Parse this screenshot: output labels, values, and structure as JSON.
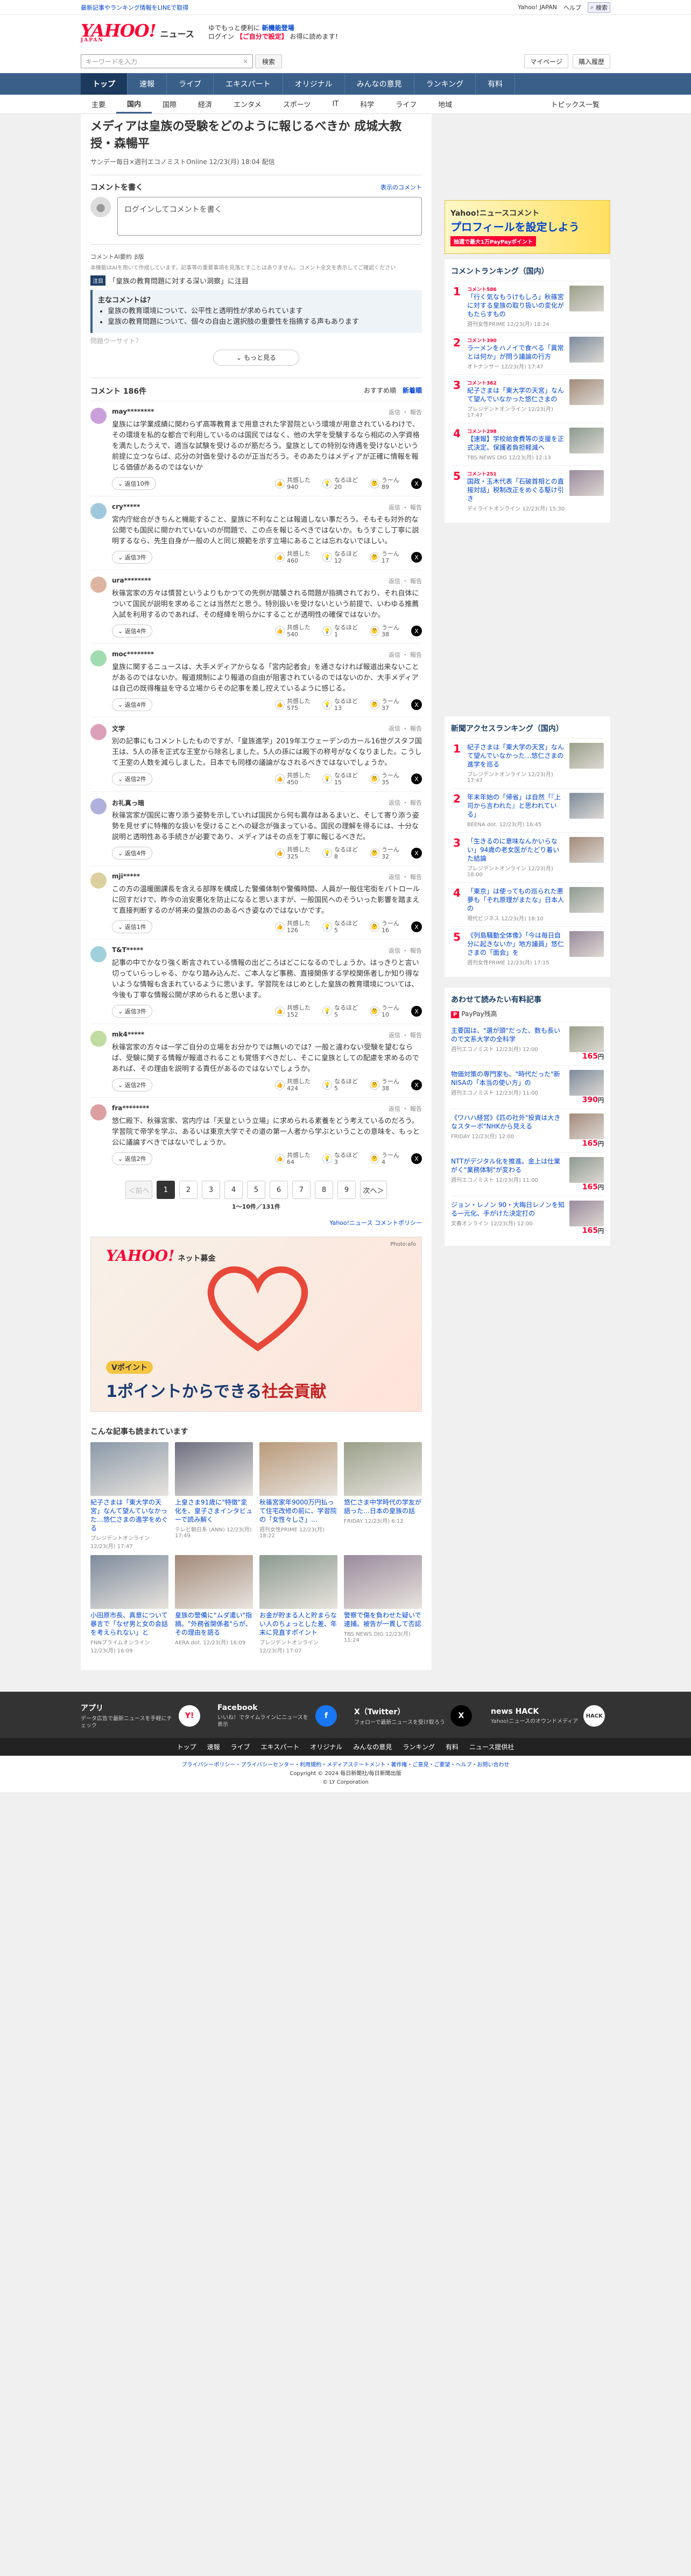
{
  "topnote": {
    "left": "最新記事やランキング情報をLINEで取得",
    "links": [
      "Yahoo! JAPAN",
      "ヘルプ"
    ],
    "mini_search": "検索"
  },
  "header": {
    "logo": "YAHOO!",
    "logo_sub": "JAPAN",
    "title": "ニュース",
    "promo_line1": "ゆでもっと便利に",
    "promo_bold": "新機能登場",
    "promo_line2": "ログイン",
    "promo_red": "【ご自分で設定】",
    "promo_line3": "お得に読めます！"
  },
  "search": {
    "placeholder": "キーワードを入力",
    "button": "検索",
    "right": [
      "マイページ",
      "購入履歴"
    ]
  },
  "gnav": [
    "トップ",
    "速報",
    "ライブ",
    "エキスパート",
    "オリジナル",
    "みんなの意見",
    "ランキング",
    "有料"
  ],
  "snav": [
    "主要",
    "国内",
    "国際",
    "経済",
    "エンタメ",
    "スポーツ",
    "IT",
    "科学",
    "ライフ",
    "地域"
  ],
  "snav_more": "トピックス一覧",
  "article": {
    "title": "メディアは皇族の受験をどのように報じるべきか 成城大教授・森暢平",
    "meta": "サンデー毎日×週刊エコノミストOnline 12/23(月) 18:04 配信"
  },
  "write": {
    "title": "コメントを書く",
    "link": "表示のコメント",
    "button": "ログインしてコメントを書く"
  },
  "ai": {
    "title": "コメントAI要約",
    "beta": "β版",
    "sub": "本機能はAIを用いて作成しています。記事等の重要事項を見落とすことはありません。コメント全文を表示してご確認ください",
    "topic_label": "注目",
    "topic": "「皇族の教育問題に対する深い洞察」に注目",
    "q_title": "主なコメントは？",
    "points": [
      "皇族の教育環境について、公平性と透明性が求められています",
      "皇族の教育問題について、個々の自由と選択肢の重要性を指摘する声もあります"
    ],
    "fade": "問題ウーサイト？",
    "more": "もっと見る"
  },
  "comments_head": {
    "title": "コメント 186件",
    "sort_a": "おすすめ順",
    "sort_b": "新着順"
  },
  "comments": [
    {
      "user": "may********",
      "time": "1時間前",
      "acts": "返信 ・ 報告",
      "text": "皇族には学業成績に関わらず高等教育まで用意された学習院という環境が用意されているわけで、その環境を私的な都合で利用しているのは国民ではなく、他の大学を受験するなら相応の入学資格を満たしたうえで、適当な試験を受けるのが筋だろう。皇族としての特別な待遇を受けないという前提に立つならば、応分の対価を受けるのが正当だろう。そのあたりはメディアが正確に情報を報じる価値があるのではないか",
      "reply": "返信10件",
      "r1": "共感した",
      "n1": "940",
      "r2": "なるほど",
      "n2": "20",
      "r3": "うーん",
      "n3": "89"
    },
    {
      "user": "cry*****",
      "time": "1時間前",
      "acts": "返信 ・ 報告",
      "text": "宮内庁総合がきちんと機能すること、皇族に不利なことは報道しない事だろう。そもそも対外的な公開でも国民に開かれていないのが問題で、この点を報じるべきではないか。もうすこし丁寧に説明するなら、先生自身が一般の人と同じ規範を示す立場にあることは忘れないでほしい。",
      "reply": "返信3件",
      "r1": "共感した",
      "n1": "460",
      "r2": "なるほど",
      "n2": "12",
      "r3": "うーん",
      "n3": "17"
    },
    {
      "user": "ura********",
      "time": "1時間前",
      "acts": "返信 ・ 報告",
      "text": "秋篠宮家の方々は慣習というよりもかつての先例が踏襲される問題が指摘されており、それ自体について国民が説明を求めることは当然だと思う。特別扱いを受けないという前提で、いわゆる推薦入試を利用するのであれば、その経緯を明らかにすることが透明性の確保ではないか。",
      "reply": "返信4件",
      "r1": "共感した",
      "n1": "540",
      "r2": "なるほど",
      "n2": "1",
      "r3": "うーん",
      "n3": "38"
    },
    {
      "user": "moc********",
      "time": "1時間前",
      "acts": "返信 ・ 報告",
      "text": "皇族に関するニュースは、大手メディアからなる「宮内記者会」を通さなければ報道出来ないことがあるのではないか。報道規制により報道の自由が阻害されているのではないのか、大手メディアは自己の既得権益を守る立場からその記事を差し控えているように感じる。",
      "reply": "返信4件",
      "r1": "共感した",
      "n1": "575",
      "r2": "なるほど",
      "n2": "13",
      "r3": "うーん",
      "n3": "37"
    },
    {
      "user": "文学",
      "time": "1時間前",
      "acts": "返信 ・ 報告",
      "text": "別の記事にもコメントしたものですが、「皇族進学」2019年エウェーデンのカール16世グスタフ国王は、5人の孫を正式な王室から除名しました。5人の孫には殿下の称号がなくなりました。こうして王室の人数を減らしました。日本でも同様の議論がなされるべきではないでしょうか。",
      "reply": "返信2件",
      "r1": "共感した",
      "n1": "450",
      "r2": "なるほど",
      "n2": "15",
      "r3": "うーん",
      "n3": "35"
    },
    {
      "user": "お礼真っ暗",
      "time": "1時間前",
      "acts": "返信 ・ 報告",
      "text": "秋篠宮家が国民に寄り添う姿勢を示していれば国民から何も異存はあるまいと、そして寄り添う姿勢を見せずに特権的な扱いを受けることへの疑念が強まっている。国民の理解を得るには、十分な説明と透明性ある手続きが必要であり、メディアはその点を丁寧に報じるべきだ。",
      "reply": "返信4件",
      "r1": "共感した",
      "n1": "325",
      "r2": "なるほど",
      "n2": "8",
      "r3": "うーん",
      "n3": "32"
    },
    {
      "user": "mji*****",
      "time": "1時間前",
      "acts": "返信 ・ 報告",
      "text": "この方の温暖圏課長を含える部隊を構成した警備体制や警備時間、人員が一般住宅街をパトロールに回すだけで、昨今の治安悪化を防止になると思いますが、一般国民へのそういった影響を踏まえて直接判断するのが将来の皇族ののあるべき姿なのではないかです。",
      "reply": "返信1件",
      "r1": "共感した",
      "n1": "126",
      "r2": "なるほど",
      "n2": "5",
      "r3": "うーん",
      "n3": "16"
    },
    {
      "user": "T&T*****",
      "time": "1時間前",
      "acts": "返信 ・ 報告",
      "text": "記事の中でかなり強く断言されている情報の出どころはどこになるのでしょうか。はっきりと言い切っていらっしゃる、かなり踏み込んだ、ご本人など事務、直接関係する学校関係者しか知り得ないような情報も含まれているように思います。学習院をはじめとした皇族の教育環境については、今後も丁寧な情報公開が求められると思います。",
      "reply": "返信3件",
      "r1": "共感した",
      "n1": "152",
      "r2": "なるほど",
      "n2": "5",
      "r3": "うーん",
      "n3": "10"
    },
    {
      "user": "mk4*****",
      "time": "1時間前",
      "acts": "返信 ・ 報告",
      "text": "秋篠宮家の方々は一学ご自分の立場をお分かりでは無いのでは？一般と違わない受験を望むならば、受験に関する情報が報道されることも覚悟すべきだし、そこに皇族としての配慮を求めるのであれば、その理由を説明する責任があるのではないでしょうか。",
      "reply": "返信2件",
      "r1": "共感した",
      "n1": "424",
      "r2": "なるほど",
      "n2": "5",
      "r3": "うーん",
      "n3": "38"
    },
    {
      "user": "fra********",
      "time": "1時間前",
      "acts": "返信 ・ 報告",
      "text": "悠仁殿下、秋篠宮家、宮内庁は「天皇という立場」に求められる素養をどう考えているのだろう。学習院で帝学を学ぶ、あるいは東京大学でその道の第一人者から学ぶということの意味を、もっと公に議論すべきではないでしょうか。",
      "reply": "返信2件",
      "r1": "共感した",
      "n1": "64",
      "r2": "なるほど",
      "n2": "3",
      "r3": "うーん",
      "n3": "4"
    }
  ],
  "pager": {
    "prev": "＜前へ",
    "pages": [
      "1",
      "2",
      "3",
      "4",
      "5",
      "6",
      "7",
      "8",
      "9"
    ],
    "next": "次へ＞",
    "info": "1〜10件／131件"
  },
  "policy": "Yahoo!ニュース コメントポリシー",
  "bigad": {
    "logo": "YAHOO!",
    "logo_sub": "ネット募金",
    "photo": "Photo:afo",
    "pt": "Vポイント",
    "slogan_a": "1ポイントからできる",
    "slogan_b": "社会貢献"
  },
  "also": {
    "title": "こんな記事も読まれています",
    "items": [
      {
        "t": "紀子さまは「東大学の天宮」なんて望んていなかった…悠仁さまの進学をめぐる",
        "m": "プレジデントオンライン 12/23(月) 17:47"
      },
      {
        "t": "上皇さま91歳に\"特徴\"変化を、皇子さまインタビューで読み解く",
        "m": "テレビ朝日系 (ANN) 12/23(月) 17:49"
      },
      {
        "t": "秋篠宮家年9000万円払って住宅改修の前に、学習院の「女性々しさ」…",
        "m": "週刊女性PRIME 12/23(月) 18:22"
      },
      {
        "t": "悠仁さま中学時代の学友が語った…日本の皇族の話",
        "m": "FRIDAY 12/23(月) 6:12"
      },
      {
        "t": "小田原市長、真意について暴言で「なぜ男と女の会話を考えられない」と",
        "m": "FNNプライムオンライン 12/23(月) 16:09"
      },
      {
        "t": "皇族の警備に\"ムダ遣い\"指摘。\"外務省関係者\"らが、その理由を語る",
        "m": "AERA dot. 12/23(月) 16:09"
      },
      {
        "t": "お金が貯まる人と貯まらない人のちょっとした差、年末に見直すポイント",
        "m": "プレジデントオンライン 12/23(月) 17:07"
      },
      {
        "t": "警察で傷を負わせた疑いで逮捕。被告が一貫して否認",
        "m": "TBS NEWS DIG 12/23(月) 11:24"
      }
    ]
  },
  "side_ad": {
    "a": "Yahoo!ニュースコメント",
    "b": "プロフィールを設定しよう",
    "c": "抽選で最大1万PayPayポイント"
  },
  "rank1": {
    "title": "コメントランキング（国内）",
    "items": [
      {
        "n": "1",
        "t": "「行く気なもうけもしろ」秋篠宮に対する皇族の取り扱いの変化がもたらすもの",
        "m": "週刊女性PRIME 12/23(月) 18:24",
        "pv": "コメント586"
      },
      {
        "n": "2",
        "t": "ラーメンをハノイで食べる「異常とは何か」が問う議論の行方",
        "m": "オトナンサー 12/23(月) 17:47",
        "pv": "コメント390"
      },
      {
        "n": "3",
        "t": "紀子さまは「東大学の天宮」なんて望んでいなかった悠仁さまの",
        "m": "プレジデントオンライン 12/23(月) 17:47",
        "pv": "コメント362"
      },
      {
        "n": "4",
        "t": "【速報】学校給食費等の支援を正式決定。保護者負担軽減へ",
        "m": "TBS NEWS DIG 12/23(月) 12:13",
        "pv": "コメント298"
      },
      {
        "n": "5",
        "t": "国政・玉木代表「石破首相との直接対話」税制改正をめぐる駆け引き",
        "m": "ディライトオンライン 12/23(月) 15:30",
        "pv": "コメント251"
      }
    ]
  },
  "rank2": {
    "title": "新聞アクセスランキング（国内）",
    "items": [
      {
        "n": "1",
        "t": "紀子さまは「東大学の天宮」なんて望んでいなかった…悠仁さまの進学を巡る",
        "m": "プレジデントオンライン 12/23(月) 17:47"
      },
      {
        "n": "2",
        "t": "年末年始の「帰省」は自然「『上司から言われた』と思われている」",
        "m": "BEENA dot. 12/23(月) 16:45"
      },
      {
        "n": "3",
        "t": "「生きるのに意味なんかいらない」94歳の老女医がたどり着いた結論",
        "m": "プレジデントオンライン 12/23(月) 18:00"
      },
      {
        "n": "4",
        "t": "「東京」は使ってもの巡られた悪夢も「それ原理がまたな」日本人の",
        "m": "現代ビジネス 12/23(月) 18:10"
      },
      {
        "n": "5",
        "t": "《列島騒動全体像》「今は毎日自分に起きないか」地方議員」悠仁さまの「面会」を",
        "m": "週刊女性PRIME 12/23(月) 17:15"
      }
    ]
  },
  "rank3": {
    "title": "あわせて読みたい有料記事",
    "paypay": "PayPay残高",
    "items": [
      {
        "t": "主要国は、\"選が頭\"だった、数も長いので文系大学の全科学",
        "m": "週刊エコノミスト 12/23(月) 12:00",
        "price": "165"
      },
      {
        "t": "物価対策の専門家も、\"時代だった\"新NISAの「本当の使い方」の",
        "m": "週刊エコノミスト 12/23(月) 11:00",
        "price": "390"
      },
      {
        "t": "《ワハハ経営》《匹の社外\"投資は大きなスターボ\"NHKから見える",
        "m": "FRIDAY 12/23(月) 12:00",
        "price": "165"
      },
      {
        "t": "NTTがデジタル化を推進。金上は仕業がく\"業務体制\"が変わる",
        "m": "週刊エコノミスト 12/23(月) 11:00",
        "price": "165"
      },
      {
        "t": "ジョン・レノン 90・大晦日レノンを知る一元化、手がけた決定打の",
        "m": "文春オンライン 12/23(月) 12:00",
        "price": "165"
      }
    ]
  },
  "footer": {
    "apps": [
      {
        "t": "アプリ",
        "d": "データ広告で最新ニュースを手軽にチェック",
        "ic": "Y!"
      },
      {
        "t": "Facebook",
        "d": "いいね！でタイムラインにニュースを表示",
        "ic": "f"
      },
      {
        "t": "X（Twitter）",
        "d": "フォローで最新ニュースを受け取ろう",
        "ic": "X"
      },
      {
        "t": "news HACK",
        "d": "Yahoo!ニュースのオウンドメディア",
        "ic": "HACK"
      }
    ],
    "nav": [
      "トップ",
      "速報",
      "ライブ",
      "エキスパート",
      "オリジナル",
      "みんなの意見",
      "ランキング",
      "有料",
      "ニュース提供社"
    ],
    "legal_links": "プライバシーポリシー・プライバシーセンター・利用規約・メディアステートメント・著作権・ご意見・ご要望・ヘルプ・お問い合わせ",
    "copyright": "Copyright © 2024 毎日新聞社/毎日新聞出版",
    "corp": "© LY Corporation"
  }
}
